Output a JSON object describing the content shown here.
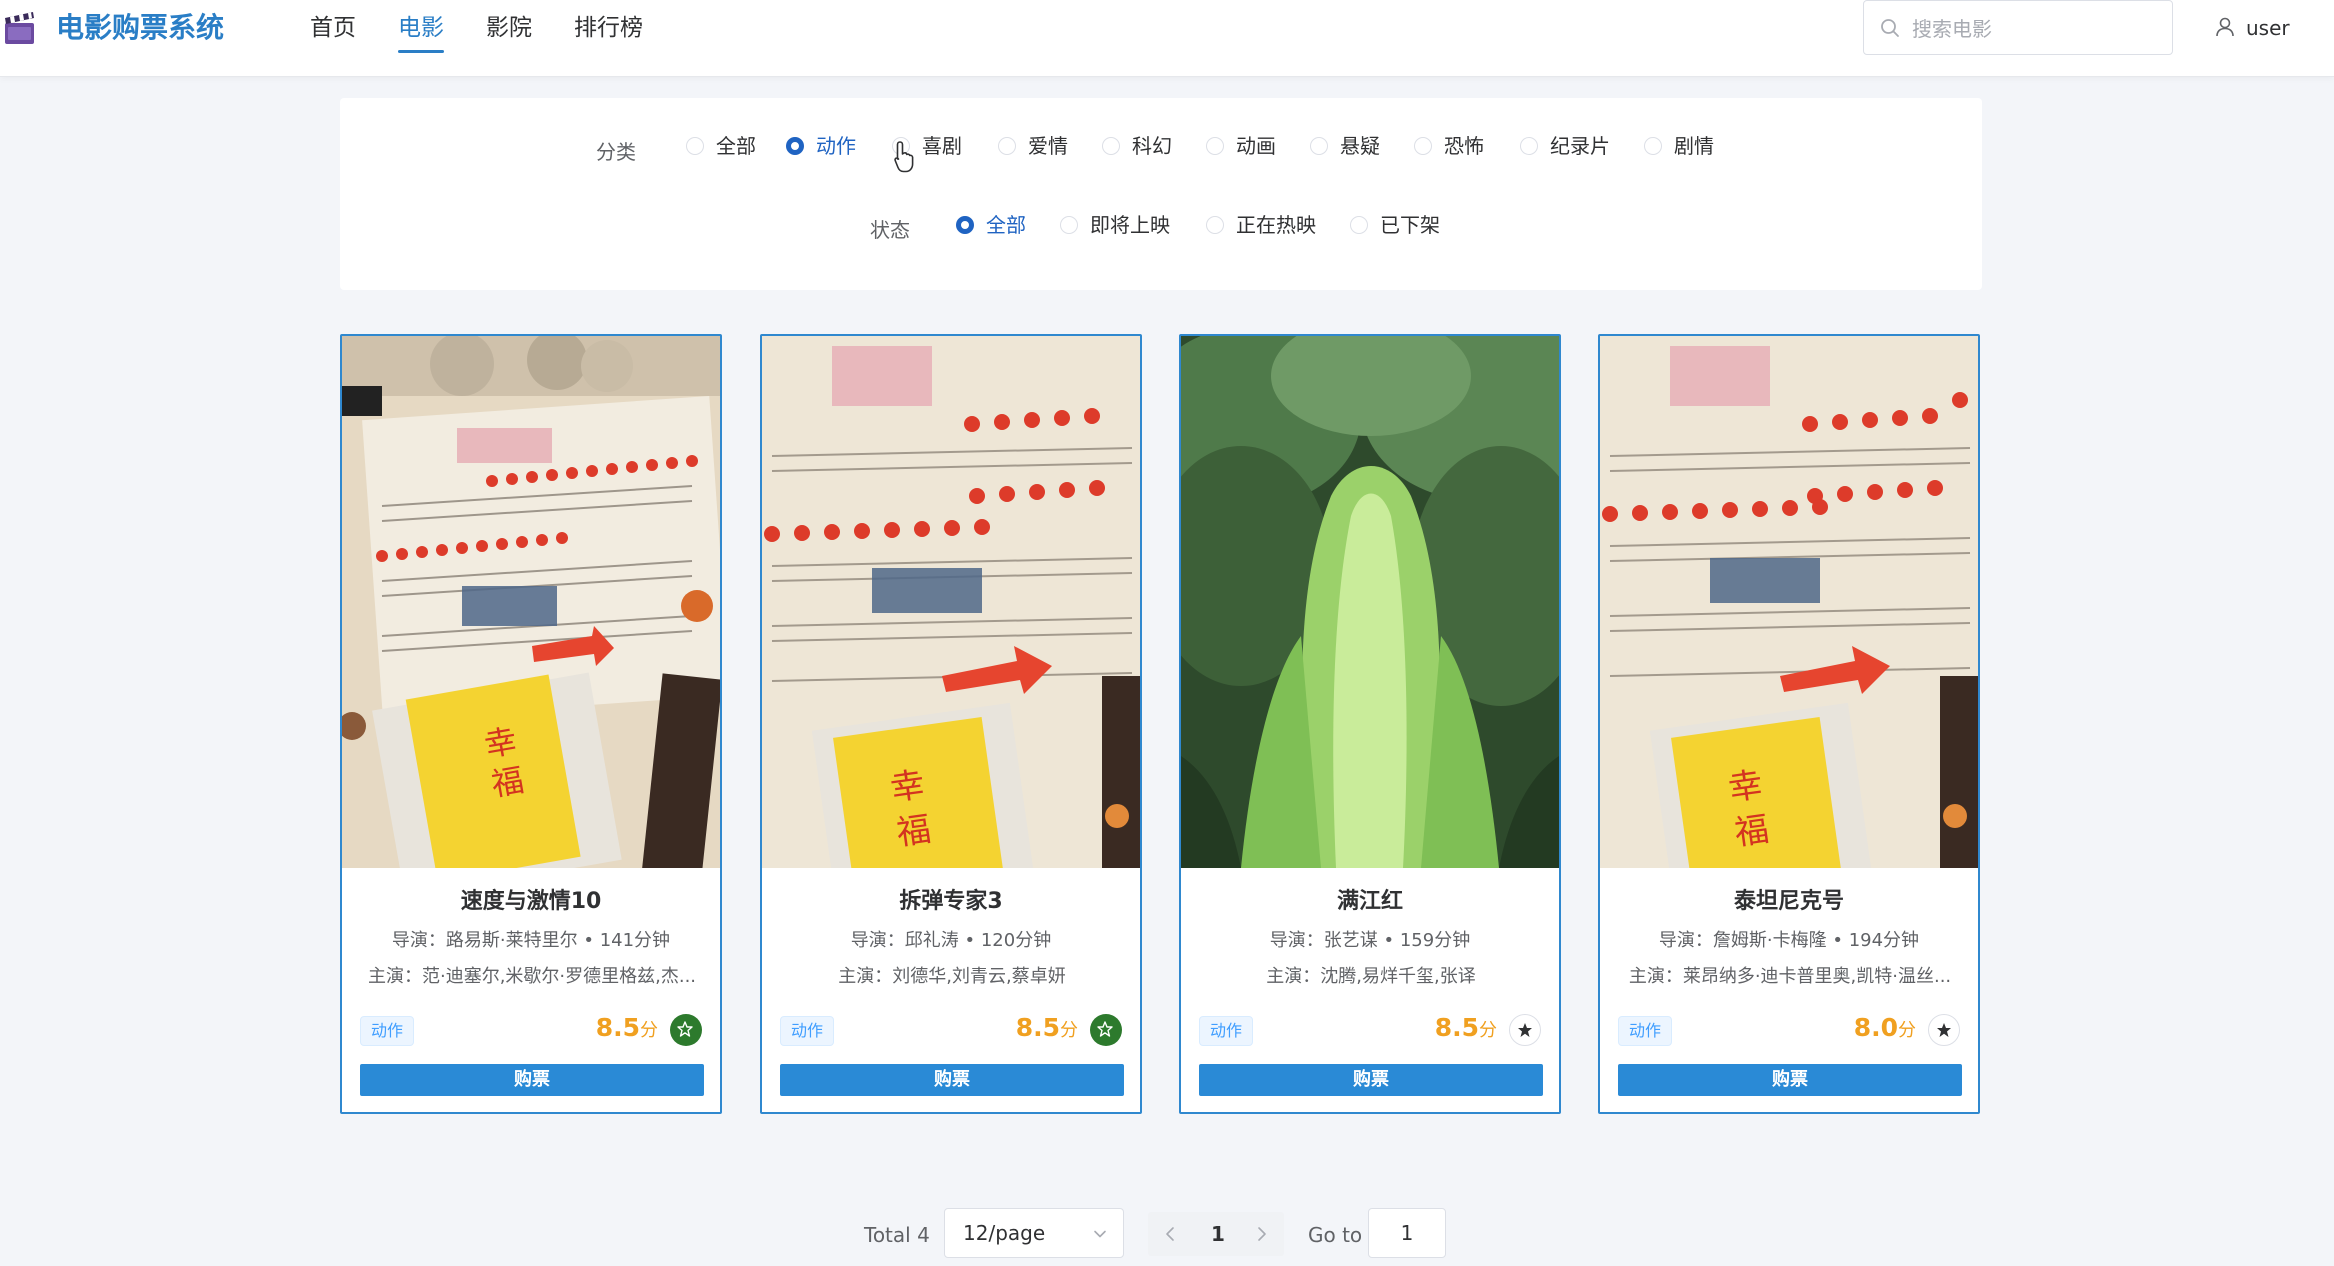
{
  "header": {
    "brand": "电影购票系统",
    "nav": [
      {
        "label": "首页"
      },
      {
        "label": "电影",
        "active": true
      },
      {
        "label": "影院"
      },
      {
        "label": "排行榜"
      }
    ],
    "search_placeholder": "搜索电影",
    "user": "user"
  },
  "filters": {
    "category_label": "分类",
    "categories": [
      "全部",
      "动作",
      "喜剧",
      "爱情",
      "科幻",
      "动画",
      "悬疑",
      "恐怖",
      "纪录片",
      "剧情"
    ],
    "selected_category": "动作",
    "status_label": "状态",
    "statuses": [
      "全部",
      "即将上映",
      "正在热映",
      "已下架"
    ],
    "selected_status": "全部"
  },
  "movies": [
    {
      "title": "速度与激情10",
      "meta": "导演：路易斯·莱特里尔 • 141分钟",
      "cast": "主演：范·迪塞尔,米歇尔·罗德里格兹,杰...",
      "tag": "动作",
      "rating": "8.5",
      "rating_unit": "分",
      "favorited": true,
      "buy": "购票"
    },
    {
      "title": "拆弹专家3",
      "meta": "导演：邱礼涛 • 120分钟",
      "cast": "主演：刘德华,刘青云,蔡卓妍",
      "tag": "动作",
      "rating": "8.5",
      "rating_unit": "分",
      "favorited": true,
      "buy": "购票"
    },
    {
      "title": "满江红",
      "meta": "导演：张艺谋 • 159分钟",
      "cast": "主演：沈腾,易烊千玺,张译",
      "tag": "动作",
      "rating": "8.5",
      "rating_unit": "分",
      "favorited": false,
      "buy": "购票"
    },
    {
      "title": "泰坦尼克号",
      "meta": "导演：詹姆斯·卡梅隆 • 194分钟",
      "cast": "主演：莱昂纳多·迪卡普里奥,凯特·温丝...",
      "tag": "动作",
      "rating": "8.0",
      "rating_unit": "分",
      "favorited": false,
      "buy": "购票"
    }
  ],
  "pagination": {
    "total": "Total 4",
    "page_size": "12/page",
    "current_page": "1",
    "goto_label": "Go to",
    "goto_value": "1"
  },
  "colors": {
    "accent": "#2a7ec6",
    "radio_checked": "#1f63c2",
    "card_border": "#2f88cf",
    "buy_button": "#2a8ad6",
    "rating": "#f0a020",
    "fav_on": "#2d7a2d",
    "tag_text": "#409eff",
    "background": "#f3f5f9"
  }
}
